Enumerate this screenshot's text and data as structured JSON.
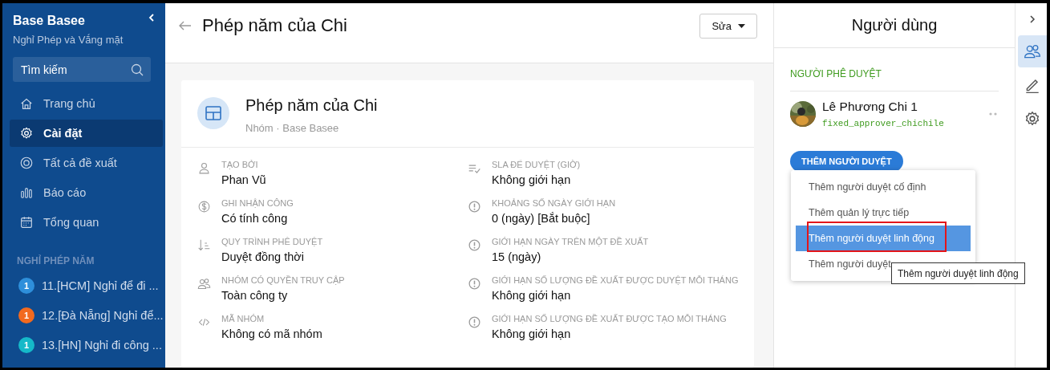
{
  "sidebar": {
    "title": "Base Basee",
    "subtitle": "Nghỉ Phép và Vắng mặt",
    "search": {
      "placeholder": "Tìm kiếm"
    },
    "nav": [
      {
        "label": "Trang chủ",
        "kind": "home",
        "selected": false
      },
      {
        "label": "Cài đặt",
        "kind": "gear",
        "selected": true
      },
      {
        "label": "Tất cả đề xuất",
        "kind": "target",
        "selected": false
      },
      {
        "label": "Báo cáo",
        "kind": "bars",
        "selected": false
      },
      {
        "label": "Tổng quan",
        "kind": "calendar",
        "selected": false
      }
    ],
    "section": "NGHỈ PHÉP NĂM",
    "groups": [
      {
        "badge": "1",
        "label": "11.[HCM] Nghỉ để đi ...",
        "color": "#2e8fdb"
      },
      {
        "badge": "1",
        "label": "12.[Đà Nẵng] Nghỉ để...",
        "color": "#f26a1f"
      },
      {
        "badge": "1",
        "label": "13.[HN] Nghỉ đi công ...",
        "color": "#15b9c9"
      }
    ]
  },
  "header": {
    "title": "Phép năm của Chi",
    "edit_button": "Sửa"
  },
  "card": {
    "title": "Phép năm của Chi",
    "subtitle": "Nhóm · Base Basee",
    "fields": [
      {
        "kind": "user",
        "label": "TẠO BỞI",
        "value": "Phan Vũ"
      },
      {
        "kind": "checklist",
        "label": "SLA ĐỂ DUYỆT (GIỜ)",
        "value": "Không giới hạn"
      },
      {
        "kind": "dollar",
        "label": "GHI NHẬN CÔNG",
        "value": "Có tính công"
      },
      {
        "kind": "alert",
        "label": "KHOẢNG SỐ NGÀY GIỚI HẠN",
        "value": "0 (ngày) [Bắt buộc]"
      },
      {
        "kind": "sort",
        "label": "QUY TRÌNH PHÊ DUYỆT",
        "value": "Duyệt đồng thời"
      },
      {
        "kind": "alert",
        "label": "GIỚI HẠN NGÀY TRÊN MỘT ĐỀ XUẤT",
        "value": "15 (ngày)"
      },
      {
        "kind": "users",
        "label": "NHÓM CÓ QUYỀN TRUY CẬP",
        "value": "Toàn công ty"
      },
      {
        "kind": "alert",
        "label": "GIỚI HẠN SỐ LƯỢNG ĐỀ XUẤT ĐƯỢC DUYỆT MỖI THÁNG",
        "value": "Không giới hạn"
      },
      {
        "kind": "code",
        "label": "MÃ NHÓM",
        "value": "Không có mã nhóm"
      },
      {
        "kind": "alert",
        "label": "GIỚI HẠN SỐ LƯỢNG ĐỀ XUẤT ĐƯỢC TẠO MỖI THÁNG",
        "value": "Không giới hạn"
      }
    ]
  },
  "panel": {
    "title": "Người dùng",
    "section": "NGƯỜI PHÊ DUYỆT",
    "approver": {
      "name": "Lê Phương Chi 1",
      "code": "fixed_approver_chichile"
    },
    "add_button": "THÊM NGƯỜI DUYỆT",
    "menu": [
      {
        "label": "Thêm người duyệt cố định",
        "selected": false,
        "outlined": false
      },
      {
        "label": "Thêm quản lý trực tiếp",
        "selected": false,
        "outlined": false
      },
      {
        "label": "Thêm người duyệt linh động",
        "selected": true,
        "outlined": true
      },
      {
        "label": "Thêm người duyệt",
        "selected": false,
        "outlined": false
      }
    ],
    "tooltip": "Thêm người duyệt linh động"
  },
  "rail": [
    {
      "kind": "users",
      "selected": true
    },
    {
      "kind": "pencil",
      "selected": false
    },
    {
      "kind": "gear",
      "selected": false
    }
  ]
}
